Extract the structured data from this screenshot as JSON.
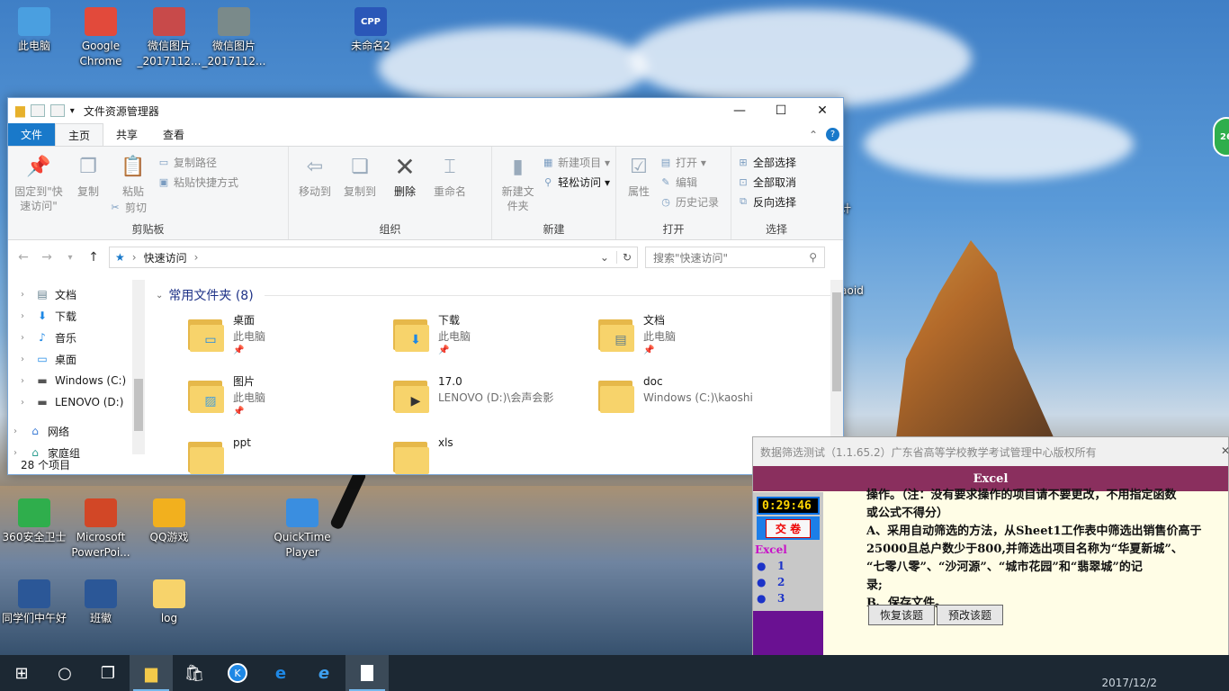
{
  "desktop": {
    "icons_top": [
      {
        "label": "此电脑",
        "icon": "computer-icon",
        "color": "#4a9fe0"
      },
      {
        "label": "Google Chrome",
        "icon": "chrome-icon",
        "color": "#e24a3b"
      },
      {
        "label": "微信图片_2017112...",
        "icon": "image-icon",
        "color": "#c84a4a"
      },
      {
        "label": "微信图片_2017112...",
        "icon": "image-icon",
        "color": "#7a8a8a"
      },
      {
        "label": "未命名2",
        "icon": "cpp-file-icon",
        "color": "#2a57b8",
        "glyph": "CPP"
      }
    ],
    "icons_bottom": [
      {
        "label": "360安全卫士",
        "icon": "360-icon",
        "color": "#2fae4c"
      },
      {
        "label": "Microsoft PowerPoi...",
        "icon": "powerpoint-icon",
        "color": "#d24726"
      },
      {
        "label": "QQ游戏",
        "icon": "qq-game-icon",
        "color": "#f2b01e"
      },
      {
        "label": "QuickTime Player",
        "icon": "quicktime-icon",
        "color": "#3a8ee0"
      }
    ],
    "icons_row3": [
      {
        "label": "同学们中午好",
        "icon": "word-doc-icon",
        "color": "#2b5797"
      },
      {
        "label": "班徽",
        "icon": "word-doc-icon",
        "color": "#2b5797"
      },
      {
        "label": "log",
        "icon": "folder-icon",
        "color": "#f7d36b"
      }
    ],
    "partial_labels": {
      "right1": "计",
      "right2": "aoid"
    },
    "side_badge": "26"
  },
  "explorer": {
    "title": "文件资源管理器",
    "tabs": {
      "file": "文件",
      "home": "主页",
      "share": "共享",
      "view": "查看"
    },
    "ribbon": {
      "clipboard": {
        "label": "剪贴板",
        "pin": "固定到\"快速访问\"",
        "copy": "复制",
        "paste": "粘贴",
        "copy_path": "复制路径",
        "paste_shortcut": "粘贴快捷方式",
        "cut": "剪切"
      },
      "organize": {
        "label": "组织",
        "move_to": "移动到",
        "copy_to": "复制到",
        "delete": "删除",
        "rename": "重命名"
      },
      "new": {
        "label": "新建",
        "new_folder": "新建文件夹",
        "new_item": "新建项目 ▾",
        "easy_access": "轻松访问 ▾"
      },
      "open": {
        "label": "打开",
        "properties": "属性",
        "open": "打开 ▾",
        "edit": "编辑",
        "history": "历史记录"
      },
      "select": {
        "label": "选择",
        "select_all": "全部选择",
        "select_none": "全部取消",
        "invert": "反向选择"
      }
    },
    "address": {
      "path": "快速访问",
      "search_placeholder": "搜索\"快速访问\""
    },
    "nav": [
      {
        "label": "文档",
        "icon": "document-icon"
      },
      {
        "label": "下载",
        "icon": "download-icon"
      },
      {
        "label": "音乐",
        "icon": "music-icon"
      },
      {
        "label": "桌面",
        "icon": "desktop-icon"
      },
      {
        "label": "Windows (C:)",
        "icon": "drive-icon"
      },
      {
        "label": "LENOVO (D:)",
        "icon": "drive-icon"
      },
      {
        "label": "网络",
        "icon": "network-icon"
      },
      {
        "label": "家庭组",
        "icon": "homegroup-icon"
      }
    ],
    "section_title": "常用文件夹 (8)",
    "folders": [
      {
        "name": "桌面",
        "location": "此电脑",
        "badge": "desktop-icon",
        "pinned": true
      },
      {
        "name": "下载",
        "location": "此电脑",
        "badge": "download-icon",
        "pinned": true
      },
      {
        "name": "文档",
        "location": "此电脑",
        "badge": "document-icon",
        "pinned": true
      },
      {
        "name": "图片",
        "location": "此电脑",
        "badge": "picture-icon",
        "pinned": true
      },
      {
        "name": "17.0",
        "location": "LENOVO (D:)\\会声会影",
        "badge": "video-icon",
        "pinned": false
      },
      {
        "name": "doc",
        "location": "Windows (C:)\\kaoshi",
        "badge": "",
        "pinned": false
      },
      {
        "name": "ppt",
        "location": "",
        "badge": "",
        "pinned": false
      },
      {
        "name": "xls",
        "location": "",
        "badge": "",
        "pinned": false
      }
    ],
    "status": "28 个项目"
  },
  "exam": {
    "title": "数据筛选测试（1.1.65.2）广东省高等学校教学考试管理中心版权所有",
    "header": "Excel",
    "timer": "0:29:46",
    "submit": "交 卷",
    "subject": "Excel",
    "questions": [
      "1",
      "2",
      "3"
    ],
    "text_lines": [
      "操作。（注：没有要求操作的项目请不要更改，不用指定函数",
      "或公式不得分）",
      "A、采用自动筛选的方法，从Sheet1工作表中筛选出销售价高于",
      "25000且总户数少于800,并筛选出项目名称为“华夏新城”、",
      "“七零八零”、“沙河源”、“城市花园”和“翡翠城”的记",
      "录;",
      "B、保存文件。"
    ],
    "restore_button": "恢复该题",
    "preview_button": "预改该题"
  },
  "taskbar": {
    "items": [
      "windows-start-icon",
      "cortana-icon",
      "task-view-icon",
      "file-explorer-icon",
      "store-icon",
      "k-app-icon",
      "edge-icon",
      "ie-icon",
      "document-icon"
    ],
    "clock_date": "2017/12/2"
  }
}
